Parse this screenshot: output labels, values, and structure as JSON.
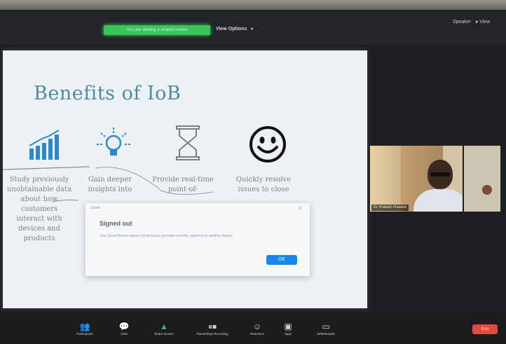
{
  "meeting": {
    "share_banner": "You are viewing a shared screen",
    "view_options_label": "View Options",
    "view_options_caret": "▾",
    "top_right_view": "Speaker",
    "top_right_dots": "● View"
  },
  "slide": {
    "title": "Benefits of IoB",
    "columns": [
      {
        "icon": "bar-chart-icon",
        "text": "Study previously unobtainable data about how customers interact with devices and products"
      },
      {
        "icon": "lightbulb-icon",
        "text": "Gain deeper insights into"
      },
      {
        "icon": "hourglass-icon",
        "text": "Provide real-time point-of-"
      },
      {
        "icon": "smiley-icon",
        "text": "Quickly resolve issues to close"
      }
    ]
  },
  "dialog": {
    "app_name": "Zoom",
    "close_glyph": "×",
    "title": "Signed out",
    "message": "Your Zoom Rooms signed out because you have recently signed in on another device.",
    "ok_label": "OK"
  },
  "participants": {
    "main_name": "Dr. Prakash Chandra",
    "self_view": ""
  },
  "toolbar": {
    "participants_label": "Participants",
    "chat_label": "Chat",
    "share_label": "Share Screen",
    "record_label": "Pause/Stop Recording",
    "reactions_label": "Reactions",
    "apps_label": "Apps",
    "whiteboards_label": "Whiteboards",
    "end_label": "End"
  },
  "colors": {
    "accent_share": "#39c45a",
    "ok_button": "#1a86e8",
    "end_button": "#e24a3f",
    "slide_title": "#4f8aa0"
  }
}
